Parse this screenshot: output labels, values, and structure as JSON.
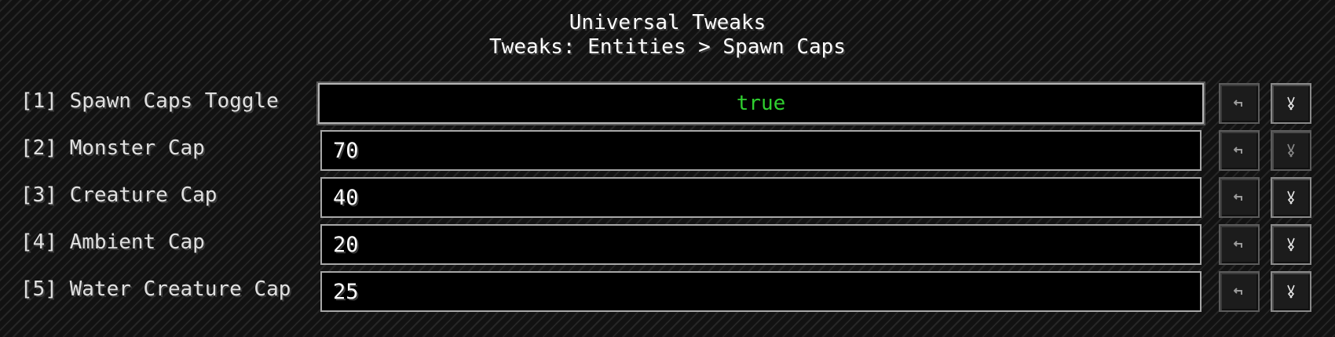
{
  "header": {
    "title": "Universal Tweaks",
    "breadcrumb": "Tweaks: Entities > Spawn Caps"
  },
  "rows": [
    {
      "label": "[1] Spawn Caps Toggle",
      "value": "true",
      "kind": "toggle"
    },
    {
      "label": "[2] Monster Cap",
      "value": "70",
      "kind": "number"
    },
    {
      "label": "[3] Creature Cap",
      "value": "40",
      "kind": "number"
    },
    {
      "label": "[4] Ambient Cap",
      "value": "20",
      "kind": "number"
    },
    {
      "label": "[5] Water Creature Cap",
      "value": "25",
      "kind": "number"
    }
  ],
  "icons": {
    "undo": "undo-arrow-icon",
    "reset": "reset-default-icon"
  },
  "colors": {
    "toggle_true": "#2fcf2f",
    "text": "#e0e0e0"
  }
}
